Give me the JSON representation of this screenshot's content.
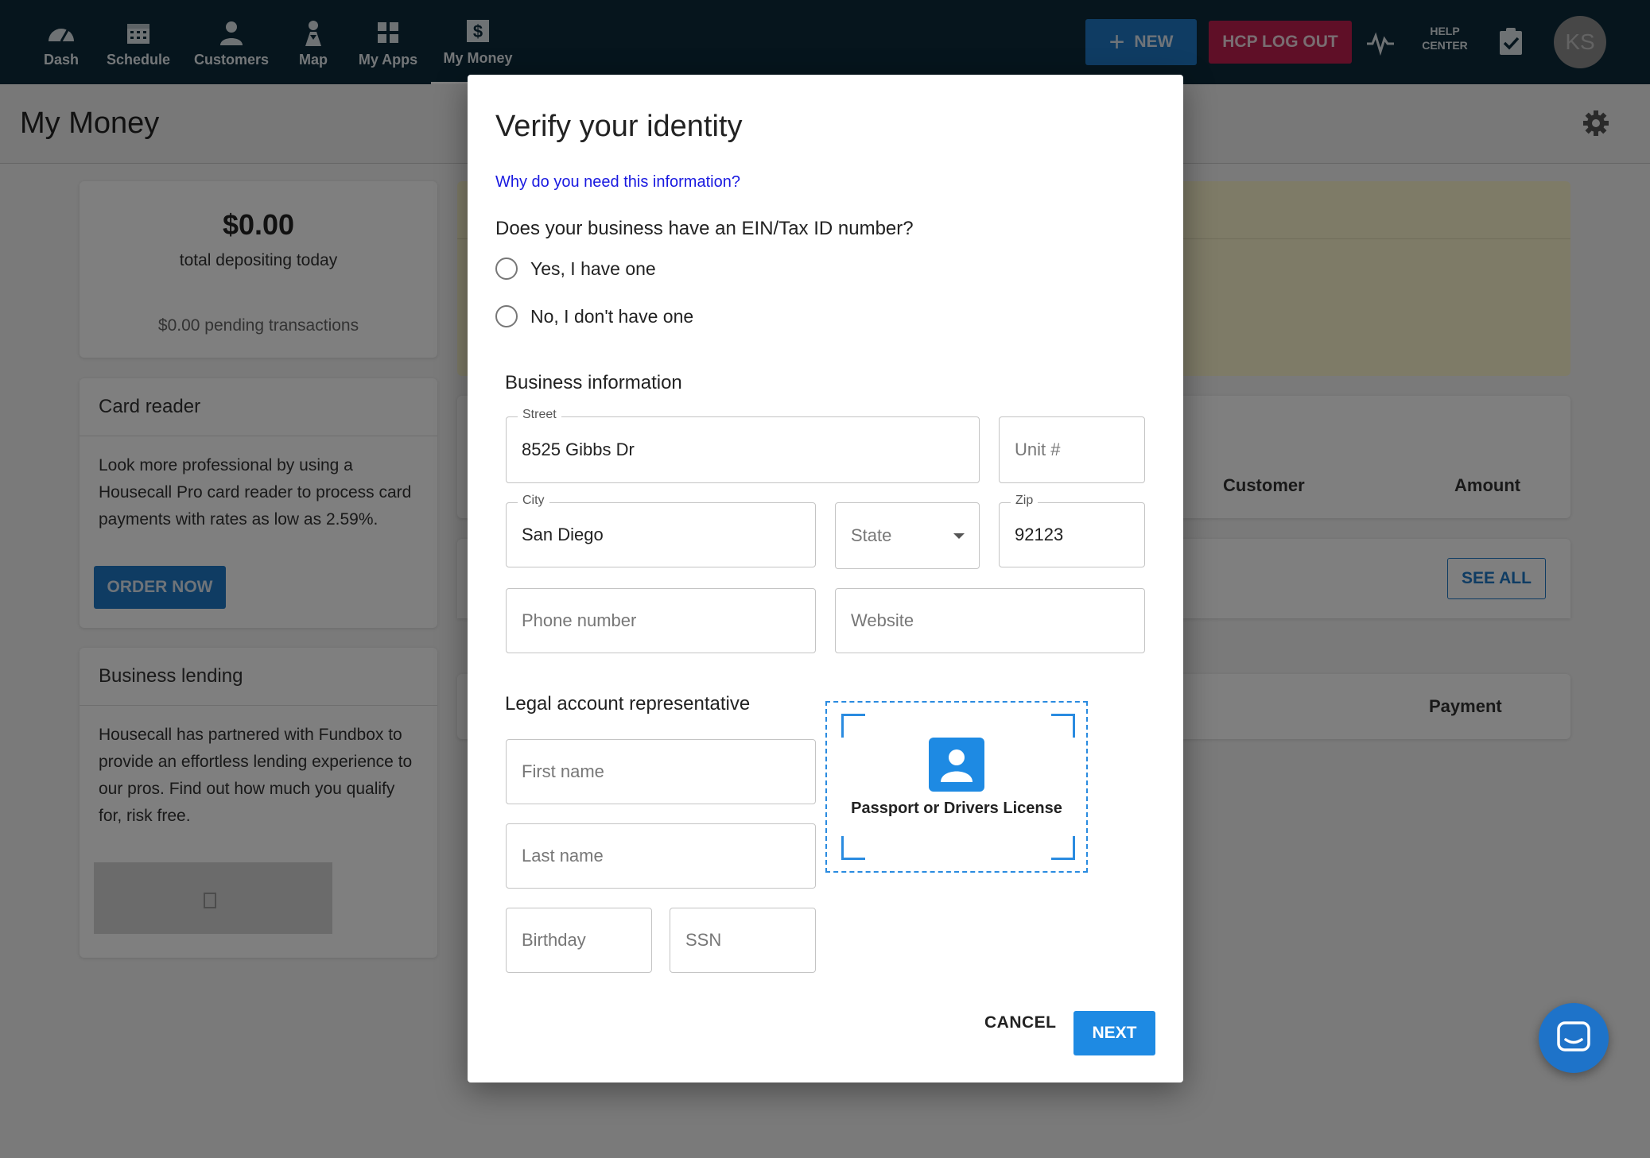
{
  "nav": {
    "items": [
      {
        "label": "Dash",
        "icon": "dashboard-gauge-icon"
      },
      {
        "label": "Schedule",
        "icon": "calendar-icon"
      },
      {
        "label": "Customers",
        "icon": "person-icon"
      },
      {
        "label": "Map",
        "icon": "map-pin-person-icon"
      },
      {
        "label": "My Apps",
        "icon": "apps-grid-icon"
      },
      {
        "label": "My Money",
        "icon": "dollar-icon"
      }
    ],
    "new_label": "NEW",
    "logout_label": "HCP LOG OUT",
    "help_line1": "HELP",
    "help_line2": "CENTER",
    "avatar_initials": "KS"
  },
  "page": {
    "title": "My Money",
    "deposit_amount": "$0.00",
    "deposit_caption": "total depositing today",
    "pending": "$0.00 pending transactions",
    "card_reader_title": "Card reader",
    "card_reader_text": "Look more professional by using a Housecall Pro card reader to process card payments with rates as low as 2.59%.",
    "order_now": "ORDER NOW",
    "lending_title": "Business lending",
    "lending_text": "Housecall has partnered with Fundbox to provide an effortless lending experience to our pros. Find out how much you qualify for, risk free.",
    "col_customer": "Customer",
    "col_amount": "Amount",
    "see_all": "SEE ALL",
    "col_payment": "Payment"
  },
  "modal": {
    "title": "Verify your identity",
    "why_link": "Why do you need this information?",
    "question": "Does your business have an EIN/Tax ID number?",
    "option_yes": "Yes, I have one",
    "option_no": "No, I don't have one",
    "business_section": "Business information",
    "street_label": "Street",
    "street_value": "8525 Gibbs Dr",
    "unit_placeholder": "Unit #",
    "city_label": "City",
    "city_value": "San Diego",
    "state_placeholder": "State",
    "zip_label": "Zip",
    "zip_value": "92123",
    "phone_placeholder": "Phone number",
    "website_placeholder": "Website",
    "legal_section": "Legal account representative",
    "first_name_placeholder": "First name",
    "last_name_placeholder": "Last name",
    "birthday_placeholder": "Birthday",
    "ssn_placeholder": "SSN",
    "id_upload_label": "Passport or Drivers License",
    "cancel": "CANCEL",
    "next": "NEXT"
  },
  "colors": {
    "topbar": "#0d2a3b",
    "primary": "#1e8ae3",
    "logout": "#bf1f4f"
  }
}
